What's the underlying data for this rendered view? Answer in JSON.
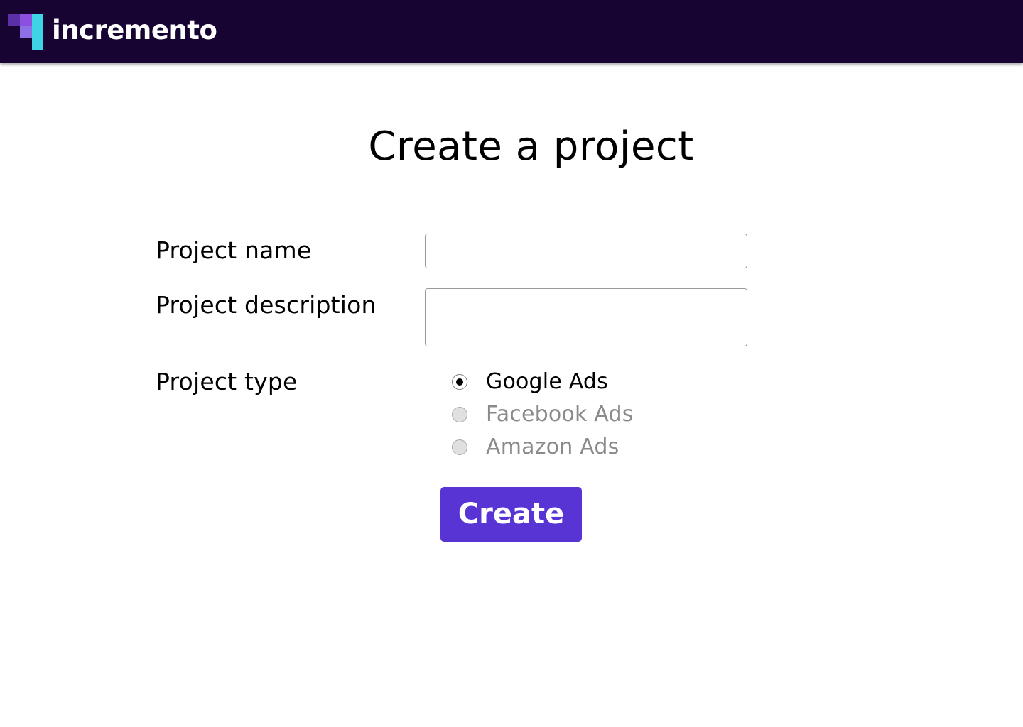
{
  "header": {
    "brand": "incremento",
    "background_color": "#180433",
    "logo_icon": "incremento-logo-icon"
  },
  "main": {
    "title": "Create a project",
    "form": {
      "project_name": {
        "label": "Project name",
        "value": ""
      },
      "project_description": {
        "label": "Project description",
        "value": ""
      },
      "project_type": {
        "label": "Project type",
        "options": [
          {
            "label": "Google Ads",
            "selected": true,
            "enabled": true
          },
          {
            "label": "Facebook Ads",
            "selected": false,
            "enabled": false
          },
          {
            "label": "Amazon Ads",
            "selected": false,
            "enabled": false
          }
        ]
      },
      "submit_label": "Create"
    }
  },
  "colors": {
    "accent": "#5834d4",
    "disabled_text": "#8a8a8a"
  }
}
